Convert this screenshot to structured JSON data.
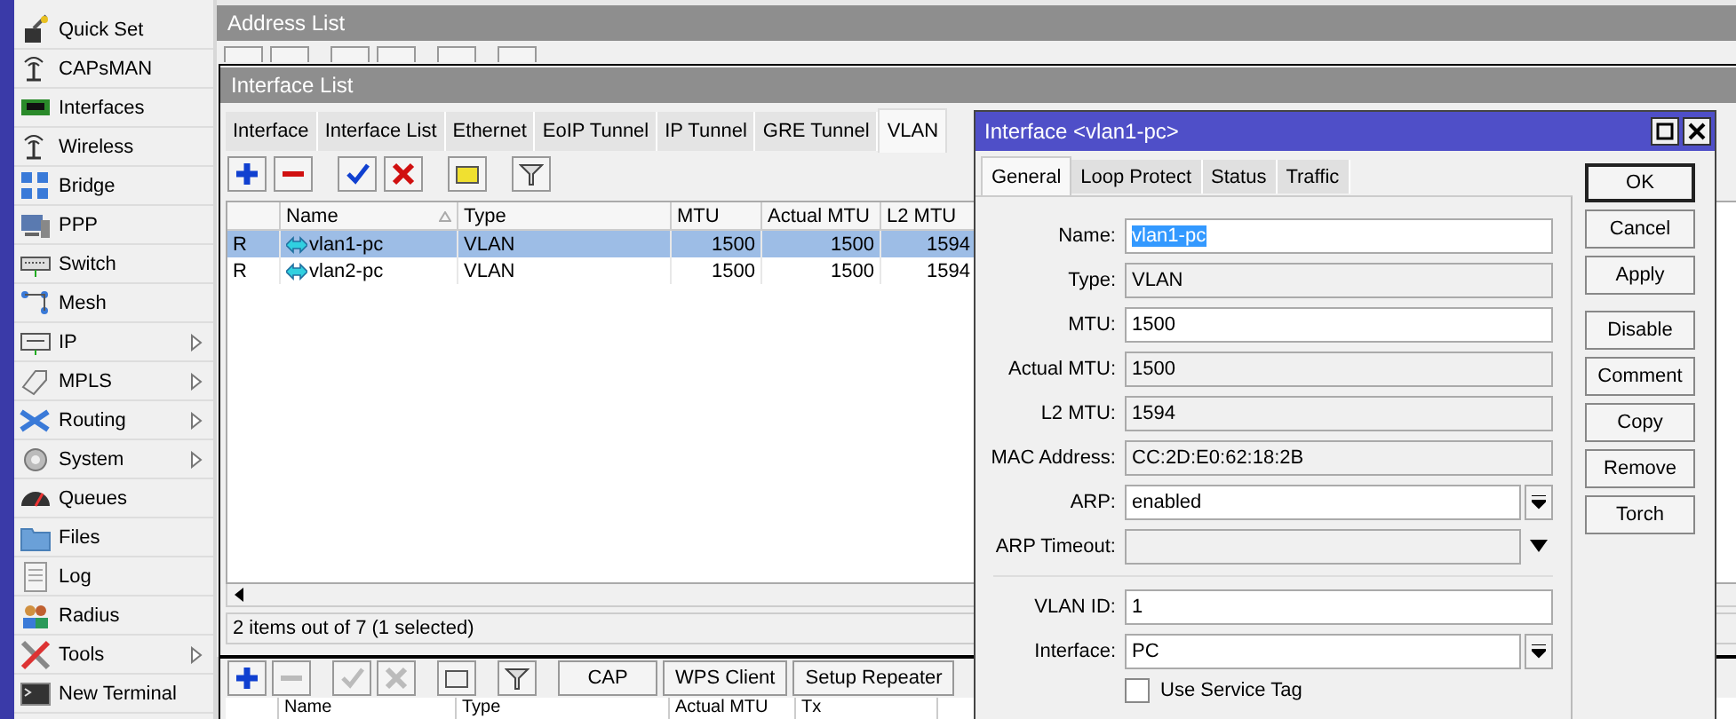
{
  "sidebar": {
    "items": [
      {
        "label": "Quick Set",
        "has_submenu": false
      },
      {
        "label": "CAPsMAN",
        "has_submenu": false
      },
      {
        "label": "Interfaces",
        "has_submenu": false
      },
      {
        "label": "Wireless",
        "has_submenu": false
      },
      {
        "label": "Bridge",
        "has_submenu": false
      },
      {
        "label": "PPP",
        "has_submenu": false
      },
      {
        "label": "Switch",
        "has_submenu": false
      },
      {
        "label": "Mesh",
        "has_submenu": false
      },
      {
        "label": "IP",
        "has_submenu": true
      },
      {
        "label": "MPLS",
        "has_submenu": true
      },
      {
        "label": "Routing",
        "has_submenu": true
      },
      {
        "label": "System",
        "has_submenu": true
      },
      {
        "label": "Queues",
        "has_submenu": false
      },
      {
        "label": "Files",
        "has_submenu": false
      },
      {
        "label": "Log",
        "has_submenu": false
      },
      {
        "label": "Radius",
        "has_submenu": false
      },
      {
        "label": "Tools",
        "has_submenu": true
      },
      {
        "label": "New Terminal",
        "has_submenu": false
      }
    ]
  },
  "address_list": {
    "title": "Address List"
  },
  "interface_list": {
    "title": "Interface List",
    "tabs": [
      {
        "label": "Interface",
        "selected": false
      },
      {
        "label": "Interface List",
        "selected": false
      },
      {
        "label": "Ethernet",
        "selected": false
      },
      {
        "label": "EoIP Tunnel",
        "selected": false
      },
      {
        "label": "IP Tunnel",
        "selected": false
      },
      {
        "label": "GRE Tunnel",
        "selected": false
      },
      {
        "label": "VLAN",
        "selected": true
      }
    ],
    "table": {
      "columns": [
        "Name",
        "Type",
        "MTU",
        "Actual MTU",
        "L2 MTU"
      ],
      "rows": [
        {
          "flag": "R",
          "name": "vlan1-pc",
          "type": "VLAN",
          "mtu": "1500",
          "actual_mtu": "1500",
          "l2_mtu": "1594",
          "selected": true
        },
        {
          "flag": "R",
          "name": "vlan2-pc",
          "type": "VLAN",
          "mtu": "1500",
          "actual_mtu": "1500",
          "l2_mtu": "1594",
          "selected": false
        }
      ]
    },
    "status": "2 items out of 7 (1 selected)"
  },
  "wireless_window": {
    "buttons": [
      "CAP",
      "WPS Client",
      "Setup Repeater"
    ],
    "columns": [
      "Name",
      "Type",
      "Actual MTU",
      "Tx"
    ]
  },
  "dialog": {
    "title": "Interface <vlan1-pc>",
    "tabs": [
      {
        "label": "General",
        "selected": true
      },
      {
        "label": "Loop Protect",
        "selected": false
      },
      {
        "label": "Status",
        "selected": false
      },
      {
        "label": "Traffic",
        "selected": false
      }
    ],
    "sections": [
      {
        "fields": [
          {
            "label": "Name:",
            "value": "vlan1-pc",
            "kind": "input",
            "text_selected": true
          },
          {
            "label": "Type:",
            "value": "VLAN",
            "kind": "readonly",
            "text_selected": false
          },
          {
            "label": "MTU:",
            "value": "1500",
            "kind": "input",
            "text_selected": false
          },
          {
            "label": "Actual MTU:",
            "value": "1500",
            "kind": "readonly",
            "text_selected": false
          },
          {
            "label": "L2 MTU:",
            "value": "1594",
            "kind": "readonly",
            "text_selected": false
          },
          {
            "label": "MAC Address:",
            "value": "CC:2D:E0:62:18:2B",
            "kind": "readonly",
            "text_selected": false
          },
          {
            "label": "ARP:",
            "value": "enabled",
            "kind": "dropdown",
            "text_selected": false
          },
          {
            "label": "ARP Timeout:",
            "kind": "unset"
          }
        ]
      },
      {
        "fields": [
          {
            "label": "VLAN ID:",
            "value": "1",
            "kind": "input",
            "text_selected": false
          },
          {
            "label": "Interface:",
            "value": "PC",
            "kind": "dropdown",
            "text_selected": false
          }
        ]
      }
    ],
    "checkbox": {
      "label": "Use Service Tag",
      "checked": false
    },
    "buttons": [
      {
        "label": "OK",
        "default": true
      },
      {
        "label": "Cancel",
        "default": false
      },
      {
        "label": "Apply",
        "default": false
      },
      {
        "label": "Disable",
        "default": false
      },
      {
        "label": "Comment",
        "default": false
      },
      {
        "label": "Copy",
        "default": false
      },
      {
        "label": "Remove",
        "default": false
      },
      {
        "label": "Torch",
        "default": false
      }
    ]
  }
}
